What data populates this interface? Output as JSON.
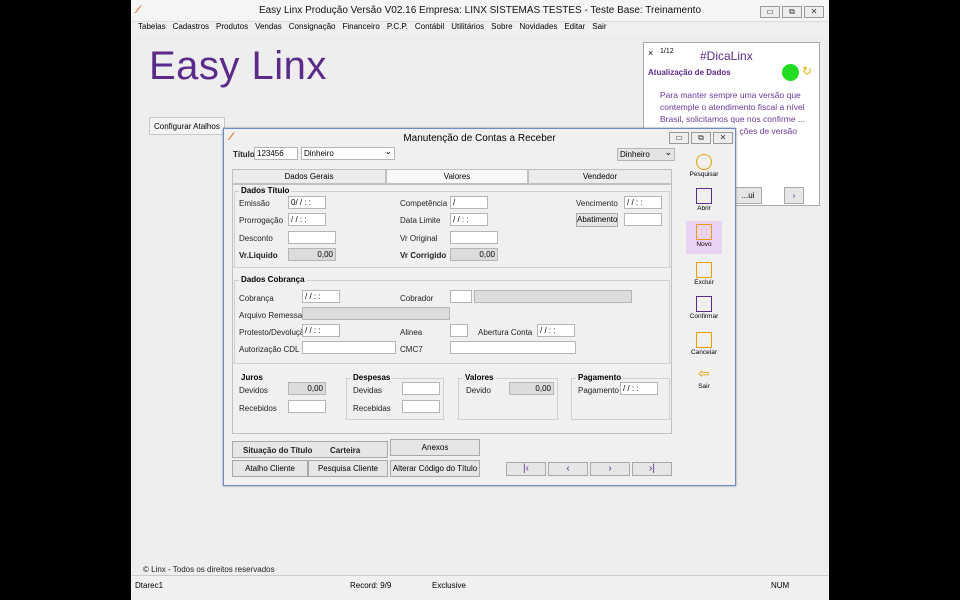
{
  "app": {
    "title": "Easy Linx Produção    Versão V02.16        Empresa: LINX SISTEMAS TESTES  -  Teste        Base: Treinamento",
    "min": "▭",
    "max": "⧉",
    "close": "✕",
    "brand": "Easy Linx",
    "atalhos": "Configurar Atalhos"
  },
  "menu": [
    "Tabelas",
    "Cadastros",
    "Produtos",
    "Vendas",
    "Consignação",
    "Financeiro",
    "P.C.P.",
    "Contábil",
    "Utilitários",
    "Sobre",
    "Novidades",
    "Editar",
    "Sair"
  ],
  "dica": {
    "close": "×",
    "page": "1/12",
    "title": "#DicaLinx",
    "subtitle": "Atualização de Dados",
    "body": "Para manter sempre uma versão que contemple o atendimento fiscal a nível Brasil, solicitamos que nos confirme ... Elas vão ser base ... ções de versão",
    "btn": "...ui",
    "next": "›"
  },
  "dialog": {
    "title": "Manutenção de Contas a Receber",
    "titulo_label": "Título",
    "titulo_value": "123456",
    "tipo": "Dinheiro",
    "tipo2": "Dinheiro",
    "tabs": [
      "Dados Gerais",
      "Valores",
      "Vendedor"
    ],
    "dados_titulo": {
      "group": "Dados Título",
      "emissao": "Emissão",
      "emissao_v": "0/ /  : :",
      "competencia": "Competência",
      "competencia_v": "/",
      "vencimento": "Vencimento",
      "vencimento_v": "/ /  : :",
      "prorrogacao": "Prorrogação",
      "prorrogacao_v": "/ /  : :",
      "data_limite": "Data Limite",
      "data_limite_v": "/ /  : :",
      "abatimento": "Abatimento",
      "desconto": "Desconto",
      "vr_original": "Vr Original",
      "vr_liquido": "Vr.Liquido",
      "vr_liquido_v": "0,00",
      "vr_corrigido": "Vr Corrigido",
      "vr_corrigido_v": "0,00"
    },
    "dados_cobranca": {
      "group": "Dados Cobrança",
      "cobranca": "Cobrança",
      "cobranca_v": "/ /  : :",
      "cobrador": "Cobrador",
      "arquivo_remessa": "Arquivo Remessa",
      "protesto": "Protesto/Devolução",
      "protesto_v": "/ /  : :",
      "alinea": "Alinea",
      "abertura": "Abertura Conta",
      "abertura_v": "/ /  : :",
      "autorizacao": "Autorização CDL",
      "cmc7": "CMC7"
    },
    "juros": {
      "group": "Juros",
      "devidos": "Devidos",
      "devidos_v": "0,00",
      "recebidos": "Recebidos"
    },
    "despesas": {
      "group": "Despesas",
      "devidas": "Devidas",
      "recebidas": "Recebidas"
    },
    "valores": {
      "group": "Valores",
      "devido": "Devido",
      "devido_v": "0,00"
    },
    "pagamento": {
      "group": "Pagamento",
      "pagamento": "Pagamento",
      "pagamento_v": "/ /  : :"
    },
    "buttons": {
      "situacao": "Situação do Título",
      "carteira": "Carteira",
      "anexos": "Anexos",
      "atalho": "Atalho Cliente",
      "pesquisa": "Pesquisa Cliente",
      "alterar": "Alterar Código do Título"
    },
    "nav": [
      "|‹",
      "‹",
      "›",
      "›|"
    ],
    "tools": [
      "Pesquisar",
      "Abrir",
      "Novo",
      "Excluir",
      "Confirmar",
      "Cancelar",
      "Sair"
    ]
  },
  "footer": "© Linx - Todos os direitos reservados",
  "status": {
    "user": "Dtarec1",
    "record": "Record: 9/9",
    "mode": "Exclusive",
    "num": "NUM"
  },
  "colors": {
    "brand": "#5b2a8a",
    "accent": "#e05a00"
  }
}
